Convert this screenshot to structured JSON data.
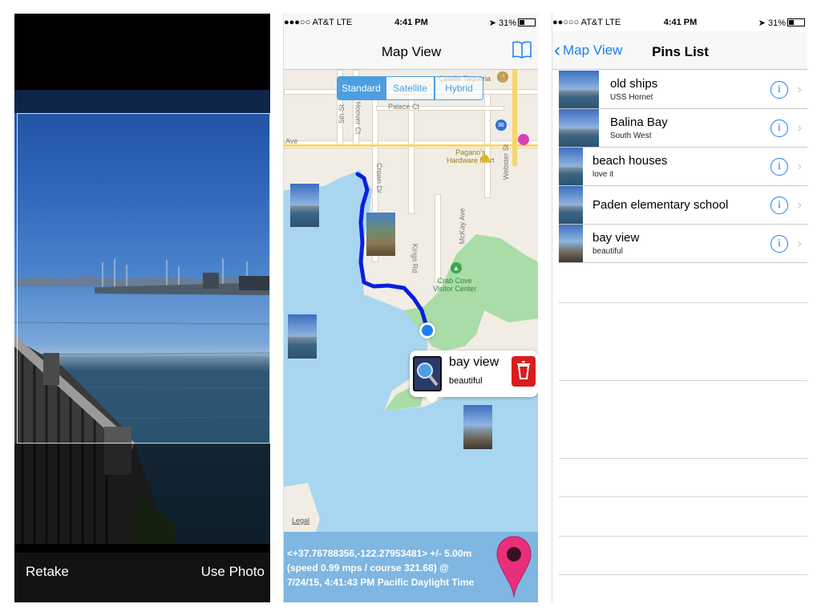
{
  "camera": {
    "retake_label": "Retake",
    "use_photo_label": "Use Photo"
  },
  "map_screen": {
    "status": {
      "signal": "●●●○○ AT&T  LTE",
      "time": "4:41 PM",
      "battery": "31%"
    },
    "title": "Map View",
    "map_type": {
      "options": [
        "Standard",
        "Satellite",
        "Hybrid"
      ],
      "selected": "Standard"
    },
    "map_labels": {
      "calafia": "Calafia Taqueria",
      "palace": "Palace Ct",
      "ave": "Ave",
      "fifth": "5th St",
      "hoover": "Hoover Ct",
      "crown": "Crown Dr",
      "paganos_1": "Pagano's",
      "paganos_2": "Hardware Mart",
      "webster": "Webster St",
      "mckay": "McKay Ave",
      "kings": "Kings Rd",
      "crab_cove_1": "Crab Cove",
      "crab_cove_2": "Visitor Center",
      "legal": "Legal"
    },
    "callout": {
      "title": "bay view",
      "subtitle": "beautiful"
    },
    "location_info": {
      "line1": "<+37.76788356,-122.27953481> +/- 5.00m",
      "line2": "(speed 0.99 mps / course 321.68) @",
      "line3": "7/24/15, 4:41:43 PM Pacific Daylight Time"
    }
  },
  "pins_screen": {
    "status": {
      "signal": "●●○○○ AT&T  LTE",
      "time": "4:41 PM",
      "battery": "31%"
    },
    "back_label": "Map View",
    "title": "Pins List",
    "pins": [
      {
        "title": "old ships",
        "subtitle": "USS Hornet"
      },
      {
        "title": "Balina Bay",
        "subtitle": "South West"
      },
      {
        "title": "beach houses",
        "subtitle": "love it"
      },
      {
        "title": "Paden elementary school",
        "subtitle": ""
      },
      {
        "title": "bay view",
        "subtitle": "beautiful"
      }
    ]
  },
  "colors": {
    "ios_blue": "#1a7ff5",
    "route_blue": "#0a1fe0",
    "water": "#a8d6f0",
    "park": "#a9dca6",
    "info_bar": "#7fb6e2",
    "pin_pink": "#e8307a"
  }
}
